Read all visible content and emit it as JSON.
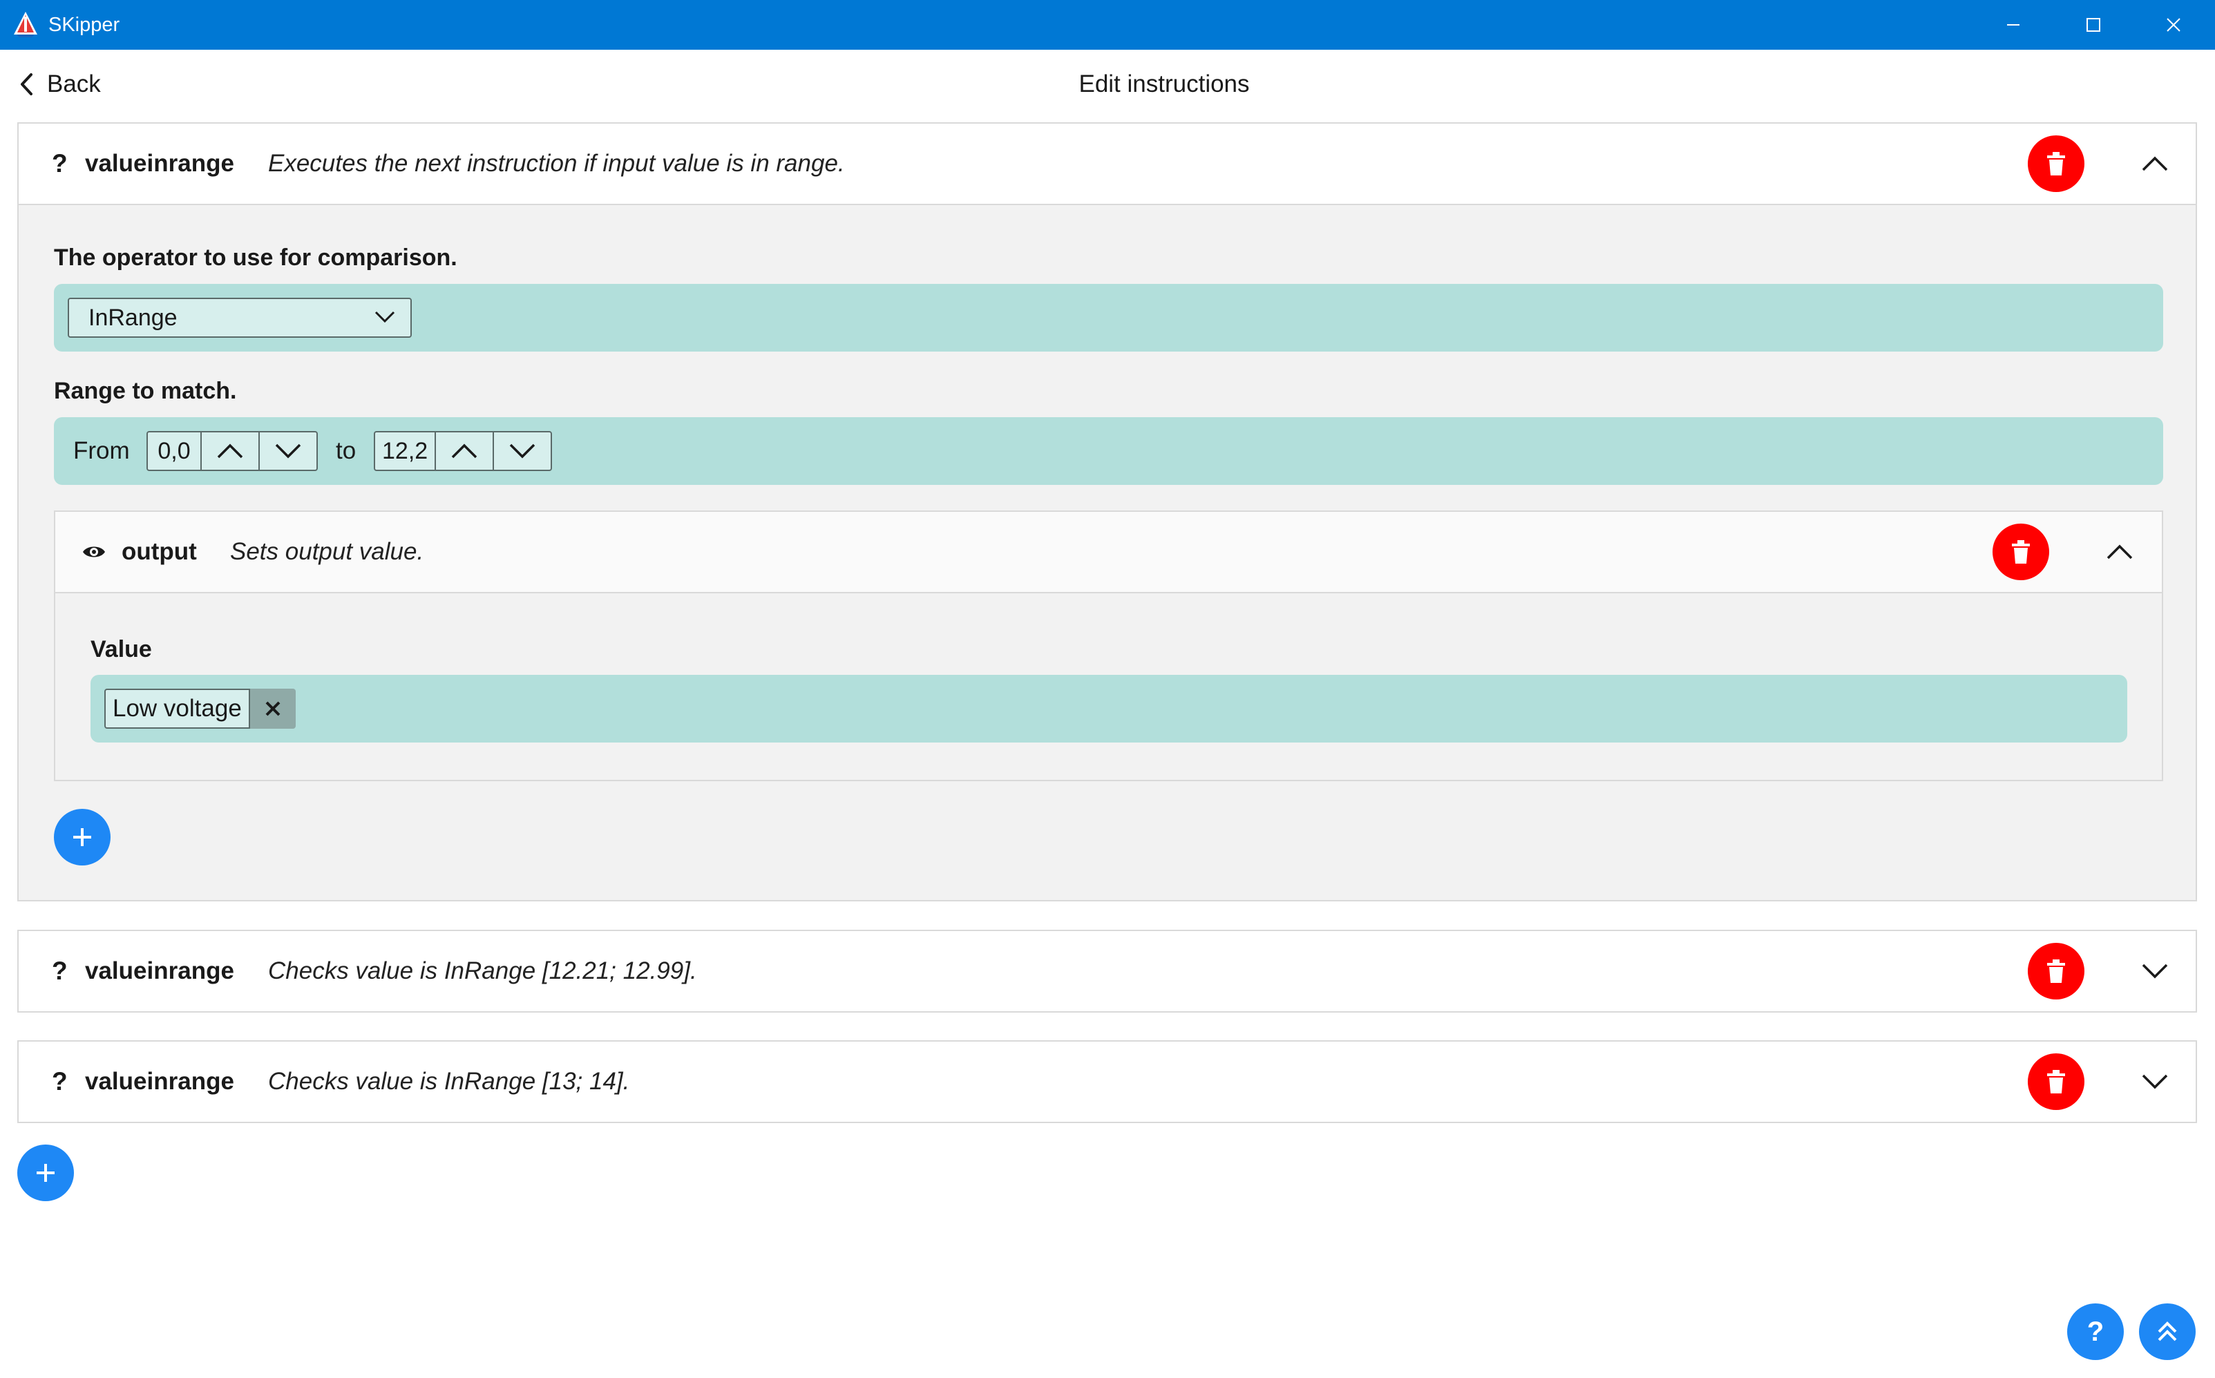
{
  "window": {
    "title": "SKipper",
    "controls": [
      "minimize",
      "maximize",
      "close"
    ]
  },
  "header": {
    "back_label": "Back",
    "page_title": "Edit instructions"
  },
  "instructions": [
    {
      "mark": "?",
      "name": "valueinrange",
      "description": "Executes the next instruction if input value is in range.",
      "expanded": true,
      "operator_label": "The operator to use for comparison.",
      "operator_value": "InRange",
      "range_label": "Range to match.",
      "range_from_label": "From",
      "range_from_value": "0,0",
      "range_to_label": "to",
      "range_to_value": "12,2",
      "children": [
        {
          "icon": "eye-icon",
          "name": "output",
          "description": "Sets output value.",
          "expanded": true,
          "value_label": "Value",
          "value": "Low voltage"
        }
      ]
    },
    {
      "mark": "?",
      "name": "valueinrange",
      "description": "Checks value is InRange [12.21; 12.99].",
      "expanded": false
    },
    {
      "mark": "?",
      "name": "valueinrange",
      "description": "Checks value is InRange [13; 14].",
      "expanded": false
    }
  ],
  "floating": {
    "help_label": "?",
    "scroll_top_icon": "double-chevron-up-icon"
  },
  "colors": {
    "titlebar": "#0078d4",
    "delete": "#ff0000",
    "accent": "#1e88f5",
    "field_bg": "#b2dfdb"
  }
}
